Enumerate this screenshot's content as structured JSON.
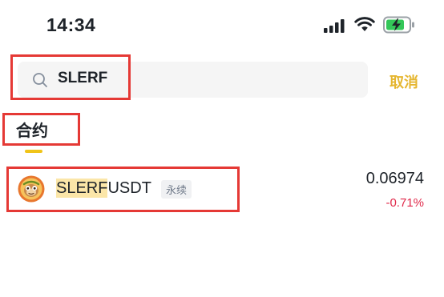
{
  "status_bar": {
    "time": "14:34",
    "icons": [
      "cellular-signal-icon",
      "wifi-icon",
      "battery-charging-icon"
    ]
  },
  "search": {
    "value": "SLERF",
    "icon": "search-icon",
    "cancel_label": "取消"
  },
  "tabs": [
    {
      "label": "合约",
      "active": true
    }
  ],
  "results": [
    {
      "highlight": "SLERF",
      "rest": "USDT",
      "badge": "永续",
      "price": "0.06974",
      "change": "-0.71%",
      "icon": "slerf-coin-icon"
    }
  ],
  "colors": {
    "accent": "#F0C419",
    "cancel_text": "#E5B630",
    "negative": "#E0294A",
    "highlight_bg": "#FBE6A8",
    "annotation": "#E53935"
  }
}
